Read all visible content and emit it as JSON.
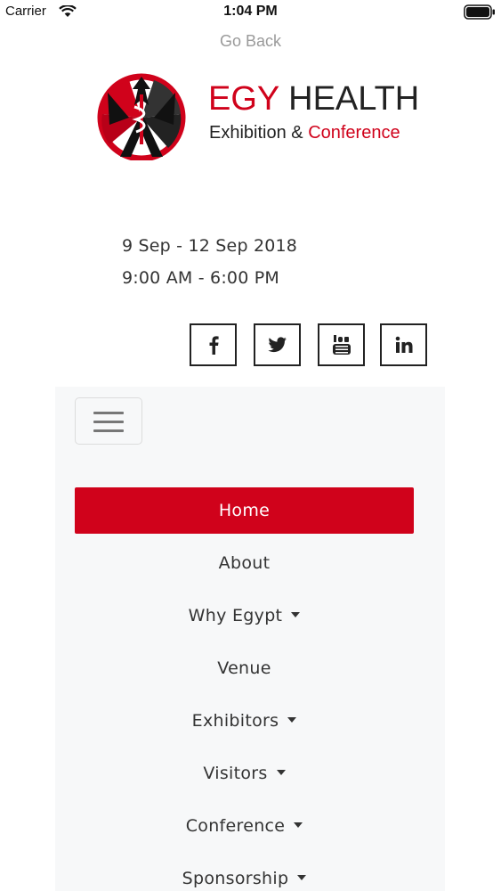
{
  "status_bar": {
    "carrier": "Carrier",
    "time": "1:04 PM"
  },
  "go_back": "Go Back",
  "brand": {
    "line1_accent": "EGY",
    "line1_main": "HEALTH",
    "line2_main": "Exhibition &",
    "line2_accent": "Conference",
    "accent_color": "#d0021b"
  },
  "event": {
    "dates": "9 Sep - 12 Sep 2018",
    "hours": "9:00 AM - 6:00 PM"
  },
  "socials": [
    {
      "icon": "facebook-icon"
    },
    {
      "icon": "twitter-icon"
    },
    {
      "icon": "youtube-icon"
    },
    {
      "icon": "linkedin-icon"
    }
  ],
  "menu": {
    "items": [
      {
        "label": "Home",
        "active": true,
        "dropdown": false
      },
      {
        "label": "About",
        "active": false,
        "dropdown": false
      },
      {
        "label": "Why Egypt",
        "active": false,
        "dropdown": true
      },
      {
        "label": "Venue",
        "active": false,
        "dropdown": false
      },
      {
        "label": "Exhibitors",
        "active": false,
        "dropdown": true
      },
      {
        "label": "Visitors",
        "active": false,
        "dropdown": true
      },
      {
        "label": "Conference",
        "active": false,
        "dropdown": true
      },
      {
        "label": "Sponsorship",
        "active": false,
        "dropdown": true
      }
    ]
  }
}
